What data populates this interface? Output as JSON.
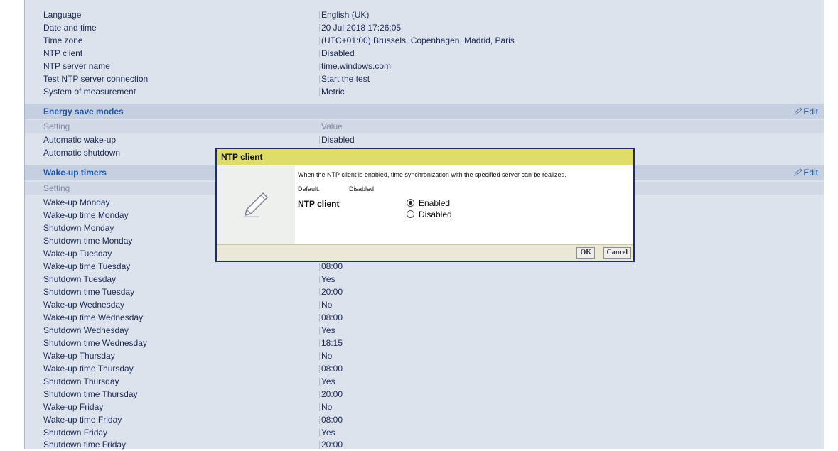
{
  "general": [
    {
      "label": "Language",
      "value": "English (UK)"
    },
    {
      "label": "Date and time",
      "value": "20 Jul 2018 17:26:05"
    },
    {
      "label": "Time zone",
      "value": "(UTC+01:00) Brussels, Copenhagen, Madrid, Paris"
    },
    {
      "label": "NTP client",
      "value": "Disabled"
    },
    {
      "label": "NTP server name",
      "value": "time.windows.com"
    },
    {
      "label": "Test NTP server connection",
      "value": "Start the test"
    },
    {
      "label": "System of measurement",
      "value": "Metric"
    }
  ],
  "energy": {
    "title": "Energy save modes",
    "edit": "Edit",
    "col_setting": "Setting",
    "col_value": "Value",
    "rows": [
      {
        "label": "Automatic wake-up",
        "value": "Disabled"
      },
      {
        "label": "Automatic shutdown",
        "value": ""
      }
    ]
  },
  "wakeup": {
    "title": "Wake-up timers",
    "edit": "Edit",
    "col_setting": "Setting",
    "rows": [
      {
        "label": "Wake-up Monday",
        "value": ""
      },
      {
        "label": "Wake-up time Monday",
        "value": ""
      },
      {
        "label": "Shutdown Monday",
        "value": ""
      },
      {
        "label": "Shutdown time Monday",
        "value": ""
      },
      {
        "label": "Wake-up Tuesday",
        "value": ""
      },
      {
        "label": "Wake-up time Tuesday",
        "value": "08:00"
      },
      {
        "label": "Shutdown Tuesday",
        "value": "Yes"
      },
      {
        "label": "Shutdown time Tuesday",
        "value": "20:00"
      },
      {
        "label": "Wake-up Wednesday",
        "value": "No"
      },
      {
        "label": "Wake-up time Wednesday",
        "value": "08:00"
      },
      {
        "label": "Shutdown Wednesday",
        "value": "Yes"
      },
      {
        "label": "Shutdown time Wednesday",
        "value": "18:15"
      },
      {
        "label": "Wake-up Thursday",
        "value": "No"
      },
      {
        "label": "Wake-up time Thursday",
        "value": "08:00"
      },
      {
        "label": "Shutdown Thursday",
        "value": "Yes"
      },
      {
        "label": "Shutdown time Thursday",
        "value": "20:00"
      },
      {
        "label": "Wake-up Friday",
        "value": "No"
      },
      {
        "label": "Wake-up time Friday",
        "value": "08:00"
      },
      {
        "label": "Shutdown Friday",
        "value": "Yes"
      },
      {
        "label": "Shutdown time Friday",
        "value": "20:00"
      }
    ]
  },
  "dialog": {
    "title": "NTP client",
    "description": "When the NTP client is enabled, time synchronization with the specified server can be realized.",
    "default_label": "Default:",
    "default_value": "Disabled",
    "field_label": "NTP client",
    "options": [
      {
        "label": "Enabled",
        "selected": true
      },
      {
        "label": "Disabled",
        "selected": false
      }
    ],
    "ok_label": "OK",
    "cancel_label": "Cancel"
  }
}
